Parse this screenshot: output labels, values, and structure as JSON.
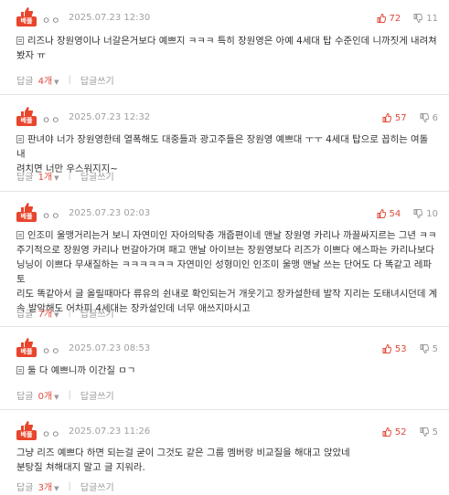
{
  "comments": [
    {
      "nick": "ㅇㅇ",
      "date": "2025.07.23 12:30",
      "badge": "베플",
      "up": "72",
      "down": "11",
      "lines": [
        "리즈나 장원영이나 너갈은거보다 예쁘지 ㅋㅋㅋ 특히 장원영은 아예 4세대 탑 수준인데 니까짓게 내려쳐",
        "봤자 ㅠ"
      ],
      "reply_label": "답글",
      "reply_count": "4개",
      "write_label": "답글쓰기"
    },
    {
      "nick": "ㅇㅇ",
      "date": "2025.07.23 12:32",
      "badge": "베플",
      "up": "57",
      "down": "6",
      "lines": [
        "판녀야 너가 장원영한테 열폭해도 대중들과 광고주들은 장원영 예쁘대 ㅜㅜ 4세대 탑으로 꼽히는 여돌 내",
        "려치면 너만 우스워지지~"
      ],
      "reply_label": "답글",
      "reply_count": "1개",
      "write_label": "답글쓰기"
    },
    {
      "nick": "ㅇㅇ",
      "date": "2025.07.23 02:03",
      "badge": "베플",
      "up": "54",
      "down": "10",
      "lines": [
        "인조미 울맹거리는거 보니 자연미인 자아의탁층 개줍편이네 맨날 장원영 카리나 까끌싸지르는 그년 ㅋㅋ",
        "주기적으로 장원영 카리나 번갈아가며 패고 맨날 아이브는 장원영보다 리즈가 이쁘다 에스파는 카리나보다",
        "닝닝이 이쁘다 무새질하는 ㅋㅋㅋㅋㅋㅋ 자연미인 성형미인 인조미 울맹 맨날 쓰는 단어도 다 똑같고 레파토",
        "리도 똑같아서 글 올릴때마다 류유의 쉰내로 확인되는거 개웃기고 장카설한테 발작 지리는 도태녀시던데 계",
        "속 발악해도 어차피 4세대는 장카설인데 너무 애쓰지마시고"
      ],
      "reply_label": "답글",
      "reply_count": "7개",
      "write_label": "답글쓰기"
    },
    {
      "nick": "ㅇㅇ",
      "date": "2025.07.23 08:53",
      "badge": "베플",
      "up": "53",
      "down": "5",
      "lines": [
        "둘 다 예쁘니까 이간질 ㅁㄱ"
      ],
      "reply_label": "답글",
      "reply_count": "0개",
      "write_label": "답글쓰기"
    },
    {
      "nick": "ㅇㅇ",
      "date": "2025.07.23 11:26",
      "badge": "베플",
      "up": "52",
      "down": "5",
      "lines": [
        "그냥 리즈 예쁘다 하면 되는걸 굳이 그것도 같은 그룹 멤버랑 비교질을 해대고 앉았네",
        "분탕질 쳐해대지 말고 글 지워라."
      ],
      "reply_label": "답글",
      "reply_count": "3개",
      "write_label": "답글쓰기"
    }
  ]
}
